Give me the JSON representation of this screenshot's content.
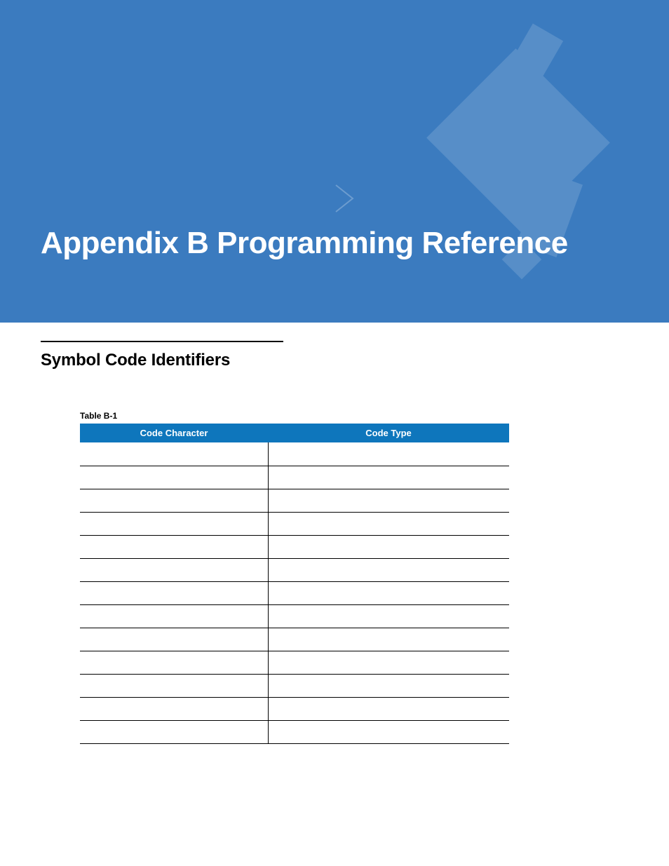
{
  "header": {
    "title": "Appendix B  Programming Reference"
  },
  "section": {
    "heading": "Symbol Code Identifiers"
  },
  "table": {
    "label": "Table B-1",
    "columns": [
      "Code Character",
      "Code Type"
    ],
    "rows": [
      [
        "",
        ""
      ],
      [
        "",
        ""
      ],
      [
        "",
        ""
      ],
      [
        "",
        ""
      ],
      [
        "",
        ""
      ],
      [
        "",
        ""
      ],
      [
        "",
        ""
      ],
      [
        "",
        ""
      ],
      [
        "",
        ""
      ],
      [
        "",
        ""
      ],
      [
        "",
        ""
      ],
      [
        "",
        ""
      ],
      [
        "",
        ""
      ]
    ]
  }
}
